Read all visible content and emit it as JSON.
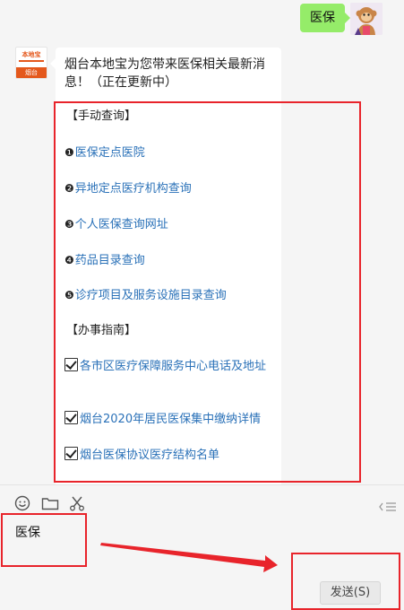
{
  "outgoing_message": "医保",
  "incoming_message": {
    "intro": "烟台本地宝为您带来医保相关最新消息！（正在更新中）",
    "sections": [
      {
        "title": "【手动查询】",
        "items": [
          {
            "num": "❶",
            "label": "医保定点医院"
          },
          {
            "num": "❷",
            "label": "异地定点医疗机构查询"
          },
          {
            "num": "❸",
            "label": "个人医保查询网址"
          },
          {
            "num": "❹",
            "label": "药品目录查询"
          },
          {
            "num": "❺",
            "label": "诊疗项目及服务设施目录查询"
          }
        ]
      },
      {
        "title": "【办事指南】",
        "items": [
          {
            "label": "各市区医疗保障服务中心电话及地址"
          },
          {
            "label": "烟台2020年居民医保集中缴纳详情"
          },
          {
            "label": "烟台医保协议医疗结构名单"
          }
        ]
      }
    ]
  },
  "account_avatar": {
    "brand_top": "本地宝",
    "brand_bottom": "烟台"
  },
  "input": {
    "value": "医保",
    "send_label": "发送(S)"
  },
  "icons": {
    "toolbar": [
      "emoji-icon",
      "folder-icon",
      "scissors-icon"
    ],
    "history": "chat-history-icon"
  },
  "colors": {
    "outgoing_bubble": "#95ec69",
    "link": "#2a71b8",
    "annotation": "#e8242b",
    "brand": "#e4581c"
  }
}
